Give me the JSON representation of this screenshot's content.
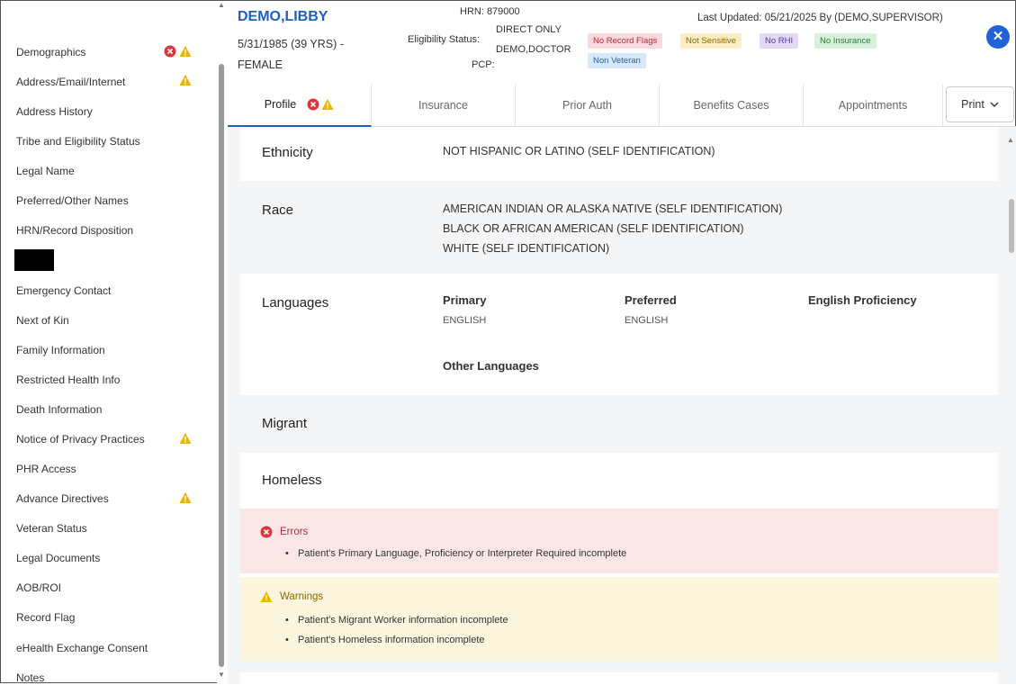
{
  "sidebar": {
    "items": [
      {
        "label": "Demographics",
        "error": true,
        "warning": true
      },
      {
        "label": "Address/Email/Internet",
        "error": false,
        "warning": true
      },
      {
        "label": "Address History",
        "error": false,
        "warning": false
      },
      {
        "label": "Tribe and Eligibility Status",
        "error": false,
        "warning": false
      },
      {
        "label": "Legal Name",
        "error": false,
        "warning": false
      },
      {
        "label": "Preferred/Other Names",
        "error": false,
        "warning": false
      },
      {
        "label": "HRN/Record Disposition",
        "error": false,
        "warning": false
      },
      {
        "label": "",
        "redacted": true
      },
      {
        "label": "Emergency Contact",
        "error": false,
        "warning": false
      },
      {
        "label": "Next of Kin",
        "error": false,
        "warning": false
      },
      {
        "label": "Family Information",
        "error": false,
        "warning": false
      },
      {
        "label": "Restricted Health Info",
        "error": false,
        "warning": false
      },
      {
        "label": "Death Information",
        "error": false,
        "warning": false
      },
      {
        "label": "Notice of Privacy Practices",
        "error": false,
        "warning": true
      },
      {
        "label": "PHR Access",
        "error": false,
        "warning": false
      },
      {
        "label": "Advance Directives",
        "error": false,
        "warning": true
      },
      {
        "label": "Veteran Status",
        "error": false,
        "warning": false
      },
      {
        "label": "Legal Documents",
        "error": false,
        "warning": false
      },
      {
        "label": "AOB/ROI",
        "error": false,
        "warning": false
      },
      {
        "label": "Record Flag",
        "error": false,
        "warning": false
      },
      {
        "label": "eHealth Exchange Consent",
        "error": false,
        "warning": false
      },
      {
        "label": "Notes",
        "error": false,
        "warning": false
      }
    ]
  },
  "header": {
    "patient_name": "DEMO,LIBBY",
    "dob_age": "5/31/1985 (39 YRS) -",
    "sex": "FEMALE",
    "hrn": "HRN: 879000",
    "eligibility_label": "Eligibility Status:",
    "eligibility_value": "DIRECT ONLY",
    "doctor": "DEMO,DOCTOR",
    "pcp_label": "PCP:",
    "last_updated": "Last Updated: 05/21/2025 By (DEMO,SUPERVISOR)",
    "badges": {
      "flags": "No Record Flags",
      "sensitive": "Not Sensitive",
      "rhi": "No RHI",
      "insurance": "No Insurance",
      "veteran": "Non Veteran"
    },
    "close_icon": "close-icon"
  },
  "tabs": [
    {
      "label": "Profile"
    },
    {
      "label": "Insurance"
    },
    {
      "label": "Prior Auth"
    },
    {
      "label": "Benefits Cases"
    },
    {
      "label": "Appointments"
    }
  ],
  "print_label": "Print",
  "profile": {
    "ethnicity": {
      "label": "Ethnicity",
      "value": "NOT HISPANIC OR LATINO (SELF IDENTIFICATION)"
    },
    "race": {
      "label": "Race",
      "values": [
        "AMERICAN INDIAN OR ALASKA NATIVE (SELF IDENTIFICATION)",
        "BLACK OR AFRICAN AMERICAN (SELF IDENTIFICATION)",
        "WHITE (SELF IDENTIFICATION)"
      ]
    },
    "languages": {
      "label": "Languages",
      "primary_label": "Primary",
      "primary_value": "ENGLISH",
      "preferred_label": "Preferred",
      "preferred_value": "ENGLISH",
      "proficiency_label": "English Proficiency",
      "other_label": "Other Languages"
    },
    "migrant": {
      "label": "Migrant"
    },
    "homeless": {
      "label": "Homeless"
    }
  },
  "errors": {
    "title": "Errors",
    "items": [
      "Patient's Primary Language, Proficiency or Interpreter Required incomplete"
    ]
  },
  "warnings": {
    "title": "Warnings",
    "items": [
      "Patient's Migrant Worker information incomplete",
      "Patient's Homeless information incomplete"
    ]
  },
  "colors": {
    "accent": "#1f5fbf",
    "error": "#d9363e",
    "warning": "#f0b400"
  }
}
